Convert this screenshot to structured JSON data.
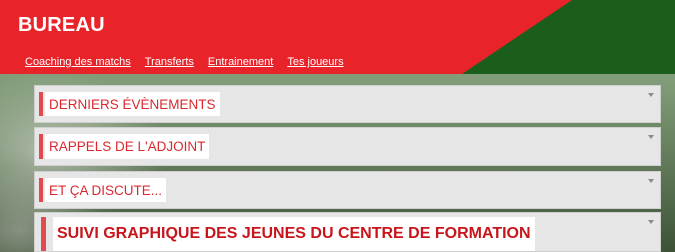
{
  "header": {
    "title": "BUREAU",
    "brand_red": "#e8242a",
    "brand_green": "#1b5e1c"
  },
  "nav": {
    "items": [
      {
        "label": "Coaching des matchs"
      },
      {
        "label": "Transferts"
      },
      {
        "label": "Entrainement"
      },
      {
        "label": "Tes joueurs"
      }
    ]
  },
  "panels": [
    {
      "label": "DERNIERS ÉVÈNEMENTS",
      "icon": "chevron-down-icon"
    },
    {
      "label": "RAPPELS DE L'ADJOINT",
      "icon": "chevron-down-icon"
    },
    {
      "label": "ET ÇA DISCUTE...",
      "icon": "chevron-down-icon"
    },
    {
      "label": "SUIVI GRAPHIQUE DES JEUNES DU CENTRE DE FORMATION",
      "icon": "chevron-down-icon"
    }
  ]
}
